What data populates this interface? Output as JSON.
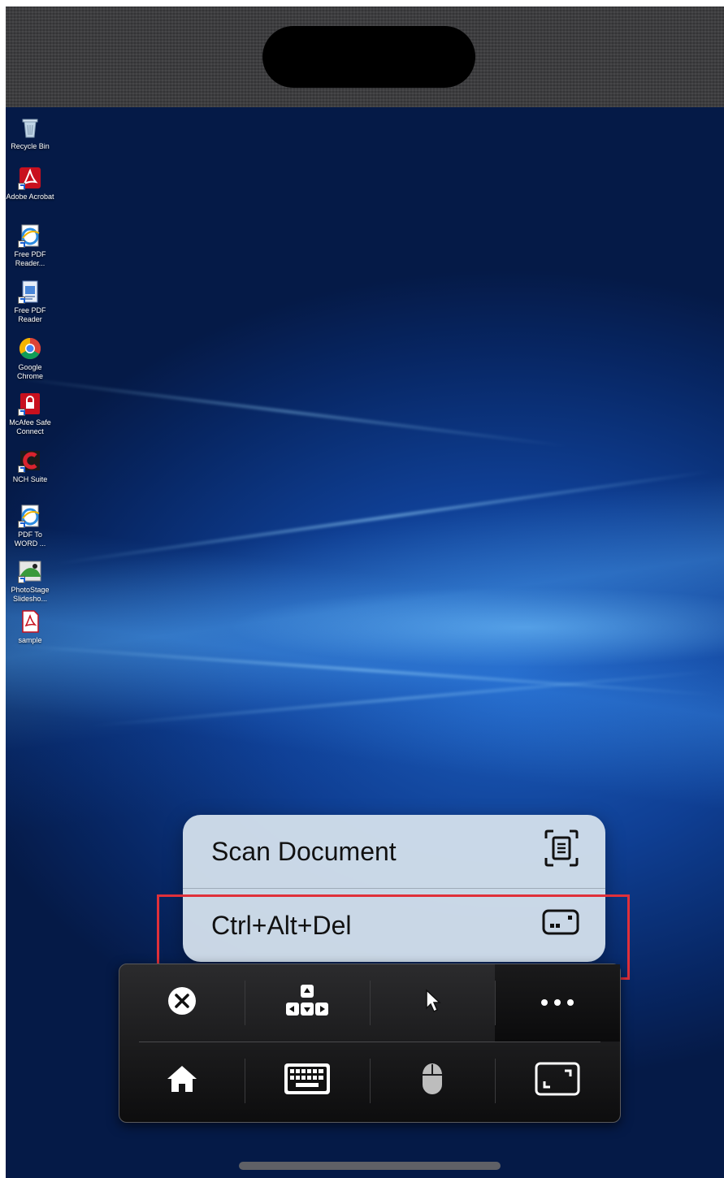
{
  "desktop": {
    "icons": [
      {
        "name": "recycle-bin",
        "label": "Recycle Bin"
      },
      {
        "name": "adobe-acrobat",
        "label": "Adobe Acrobat"
      },
      {
        "name": "free-pdf-reader-1",
        "label": "Free PDF Reader..."
      },
      {
        "name": "free-pdf-reader-2",
        "label": "Free PDF Reader"
      },
      {
        "name": "google-chrome",
        "label": "Google Chrome"
      },
      {
        "name": "mcafee-safe-connect",
        "label": "McAfee Safe Connect"
      },
      {
        "name": "nch-suite",
        "label": "NCH Suite"
      },
      {
        "name": "pdf-to-word",
        "label": "PDF To WORD ..."
      },
      {
        "name": "photostage-slideshow",
        "label": "PhotoStage Slidesho..."
      },
      {
        "name": "sample",
        "label": "sample"
      }
    ]
  },
  "menu": {
    "items": [
      {
        "label": "Scan Document",
        "icon": "document-scan-icon"
      },
      {
        "label": "Ctrl+Alt+Del",
        "icon": "keyboard-key-icon"
      }
    ]
  },
  "toolbar": {
    "row1": [
      "close-icon",
      "arrow-keys-icon",
      "pointer-icon",
      "more-icon"
    ],
    "row2": [
      "home-icon",
      "keyboard-icon",
      "mouse-icon",
      "fullscreen-icon"
    ]
  },
  "colors": {
    "highlight": "#e0303a",
    "menu_bg": "#d4e0ec",
    "toolbar_bg": "#1c1c1e"
  }
}
